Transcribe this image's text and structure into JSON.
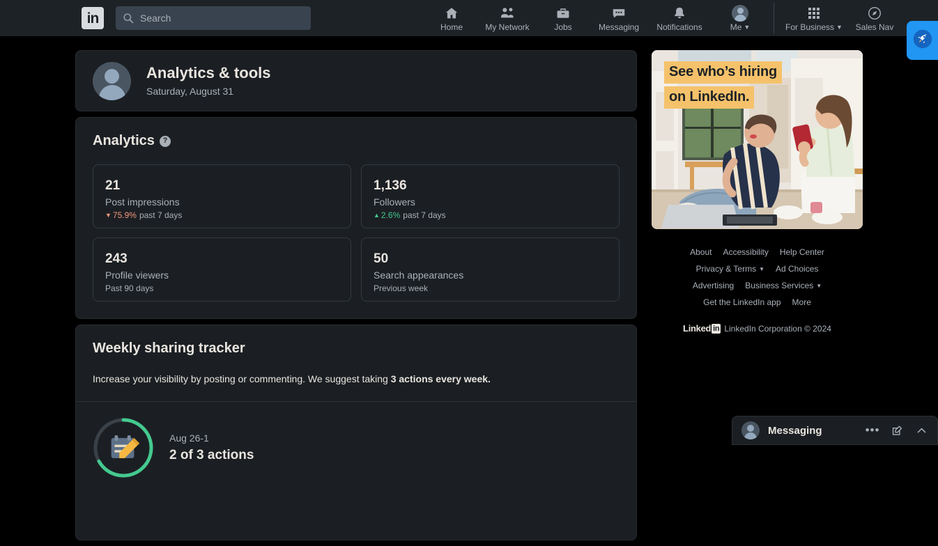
{
  "colors": {
    "nav_bg": "#1d2226",
    "page_bg": "#000000",
    "card_bg": "#1b1f23",
    "text_primary": "#e9e5df",
    "text_secondary": "#a9b0b8",
    "positive": "#44c98f",
    "negative": "#f5987e",
    "promo_highlight": "#f5c26b",
    "rocket_blue": "#2196f3"
  },
  "topnav": {
    "logo": "in",
    "logo_icon": "linkedin-logo-icon",
    "search": {
      "icon": "search-icon",
      "placeholder": "Search",
      "value": ""
    },
    "items": [
      {
        "label": "Home",
        "icon": "home-icon"
      },
      {
        "label": "My Network",
        "icon": "people-icon"
      },
      {
        "label": "Jobs",
        "icon": "briefcase-icon"
      },
      {
        "label": "Messaging",
        "icon": "message-bubble-icon"
      },
      {
        "label": "Notifications",
        "icon": "bell-icon"
      },
      {
        "label": "Me",
        "icon": "avatar-icon",
        "has_caret": true
      }
    ],
    "business": [
      {
        "label": "For Business",
        "icon": "grid-icon",
        "has_caret": true
      },
      {
        "label": "Sales Nav",
        "icon": "compass-icon"
      }
    ]
  },
  "rocket_button": {
    "icon": "rocket-icon"
  },
  "profile_header": {
    "avatar": "default-avatar-icon",
    "title": "Analytics & tools",
    "date": "Saturday, August 31"
  },
  "analytics": {
    "title": "Analytics",
    "help_icon": "help-question-icon",
    "help_glyph": "?",
    "stats": [
      {
        "value": "21",
        "label": "Post impressions",
        "trend_direction": "down",
        "trend_glyph": "▼",
        "delta": "75.9%",
        "period": "past 7 days"
      },
      {
        "value": "1,136",
        "label": "Followers",
        "trend_direction": "up",
        "trend_glyph": "▲",
        "delta": "2.6%",
        "period": "past 7 days"
      },
      {
        "value": "243",
        "label": "Profile viewers",
        "trend_direction": "none",
        "trend_glyph": "",
        "delta": "",
        "period": "Past 90 days"
      },
      {
        "value": "50",
        "label": "Search appearances",
        "trend_direction": "none",
        "trend_glyph": "",
        "delta": "",
        "period": "Previous week"
      }
    ]
  },
  "weekly_tracker": {
    "title": "Weekly sharing tracker",
    "description_prefix": "Increase your visibility by posting or commenting. We suggest taking ",
    "description_bold": "3 actions every week.",
    "progress_icon": "notepad-pencil-icon",
    "progress_completed": 2,
    "progress_total": 3,
    "progress_percent": 67,
    "date_range": "Aug 26-1",
    "actions_text": "2 of 3 actions"
  },
  "promo": {
    "line1": "See who’s hiring",
    "line2": "on LinkedIn.",
    "image_alt": "two-women-looking-at-phone-photo"
  },
  "footer": {
    "rows": [
      [
        {
          "label": "About",
          "caret": false
        },
        {
          "label": "Accessibility",
          "caret": false
        },
        {
          "label": "Help Center",
          "caret": false
        }
      ],
      [
        {
          "label": "Privacy & Terms",
          "caret": true
        },
        {
          "label": "Ad Choices",
          "caret": false
        }
      ],
      [
        {
          "label": "Advertising",
          "caret": false
        },
        {
          "label": "Business Services",
          "caret": true
        }
      ],
      [
        {
          "label": "Get the LinkedIn app",
          "caret": false
        },
        {
          "label": "More",
          "caret": false
        }
      ]
    ],
    "brand": "Linked",
    "brand_in": "in",
    "copyright": "LinkedIn Corporation © 2024"
  },
  "messaging_dock": {
    "avatar": "default-avatar-icon",
    "title": "Messaging",
    "controls": [
      {
        "icon": "more-options-icon",
        "glyph": "•••"
      },
      {
        "icon": "compose-message-icon",
        "glyph": ""
      },
      {
        "icon": "chevron-up-icon",
        "glyph": ""
      }
    ]
  }
}
